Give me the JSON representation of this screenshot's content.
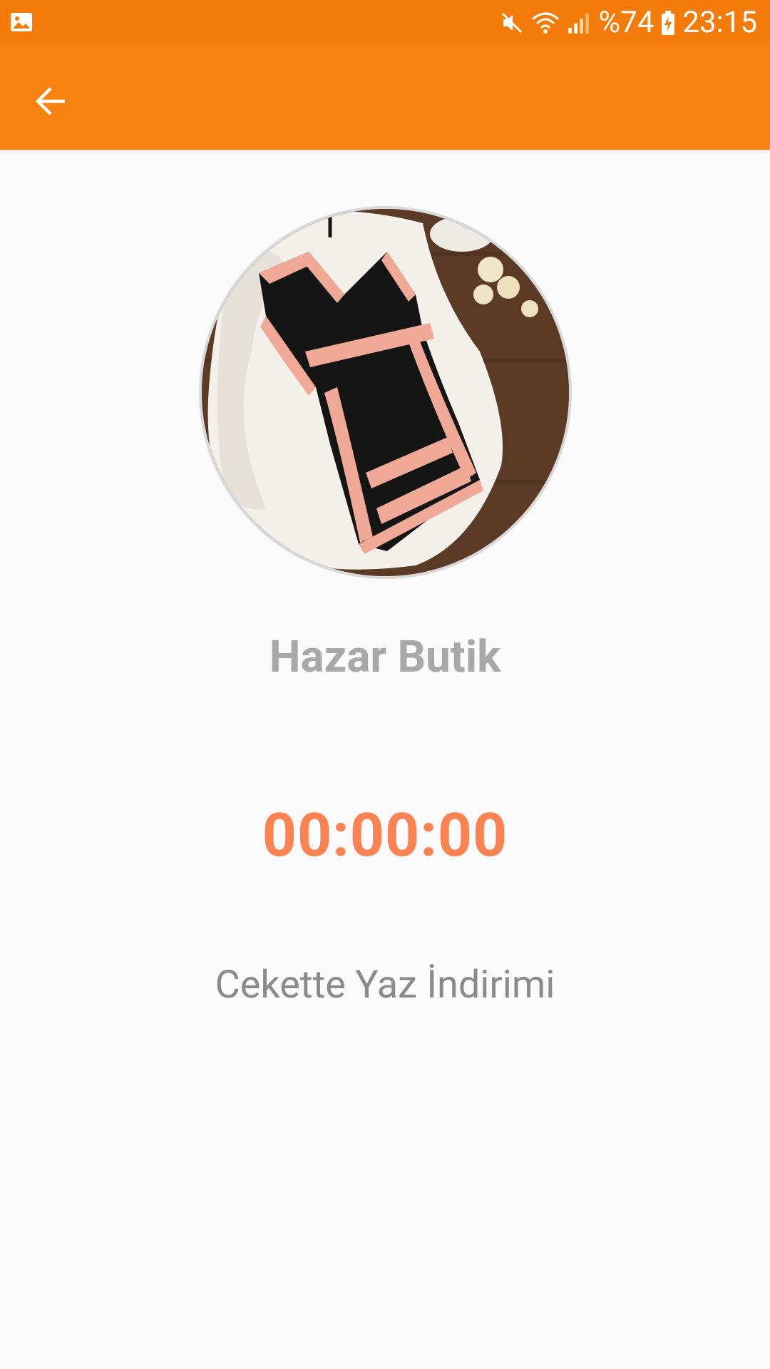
{
  "status_bar": {
    "battery_text": "%74",
    "time": "23:15",
    "icons": [
      "image-notification-icon",
      "mute-icon",
      "wifi-icon",
      "signal-icon",
      "battery-charging-icon"
    ]
  },
  "app_bar": {
    "back_icon": "arrow-back-icon"
  },
  "shop": {
    "name": "Hazar Butik",
    "image_alt": "dress-photo"
  },
  "countdown": {
    "value": "00:00:00"
  },
  "campaign": {
    "title": "Cekette Yaz İndirimi"
  },
  "colors": {
    "status_bar": "#f47b0a",
    "app_bar": "#f7820f",
    "countdown": "#fb8352",
    "shop_name": "#a8a8a8",
    "campaign_text": "#8a8a8a",
    "background": "#fafafa"
  }
}
